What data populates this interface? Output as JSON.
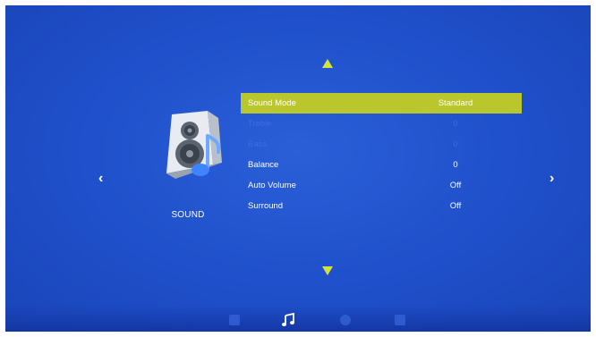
{
  "category": {
    "label": "SOUND",
    "icon": "speaker-music-note-icon"
  },
  "nav": {
    "up_icon": "arrow-up-icon",
    "down_icon": "arrow-down-icon",
    "left_glyph": "‹",
    "right_glyph": "›"
  },
  "menu": {
    "items": [
      {
        "label": "Sound Mode",
        "value": "Standard",
        "state": "selected"
      },
      {
        "label": "Treble",
        "value": "0",
        "state": "disabled"
      },
      {
        "label": "Bass",
        "value": "0",
        "state": "disabled"
      },
      {
        "label": "Balance",
        "value": "0",
        "state": "normal"
      },
      {
        "label": "Auto Volume",
        "value": "Off",
        "state": "normal"
      },
      {
        "label": "Surround",
        "value": "Off",
        "state": "normal"
      }
    ]
  },
  "bottom_bar": {
    "icons": [
      "picture-icon",
      "music-note-icon",
      "clock-icon",
      "lock-icon"
    ],
    "active": "music-note-icon"
  },
  "colors": {
    "background": "#1f4fca",
    "highlight": "#b9c62c",
    "arrow": "#d4e33a",
    "text": "#ffffff",
    "disabled_text": "#3c6ce0"
  }
}
